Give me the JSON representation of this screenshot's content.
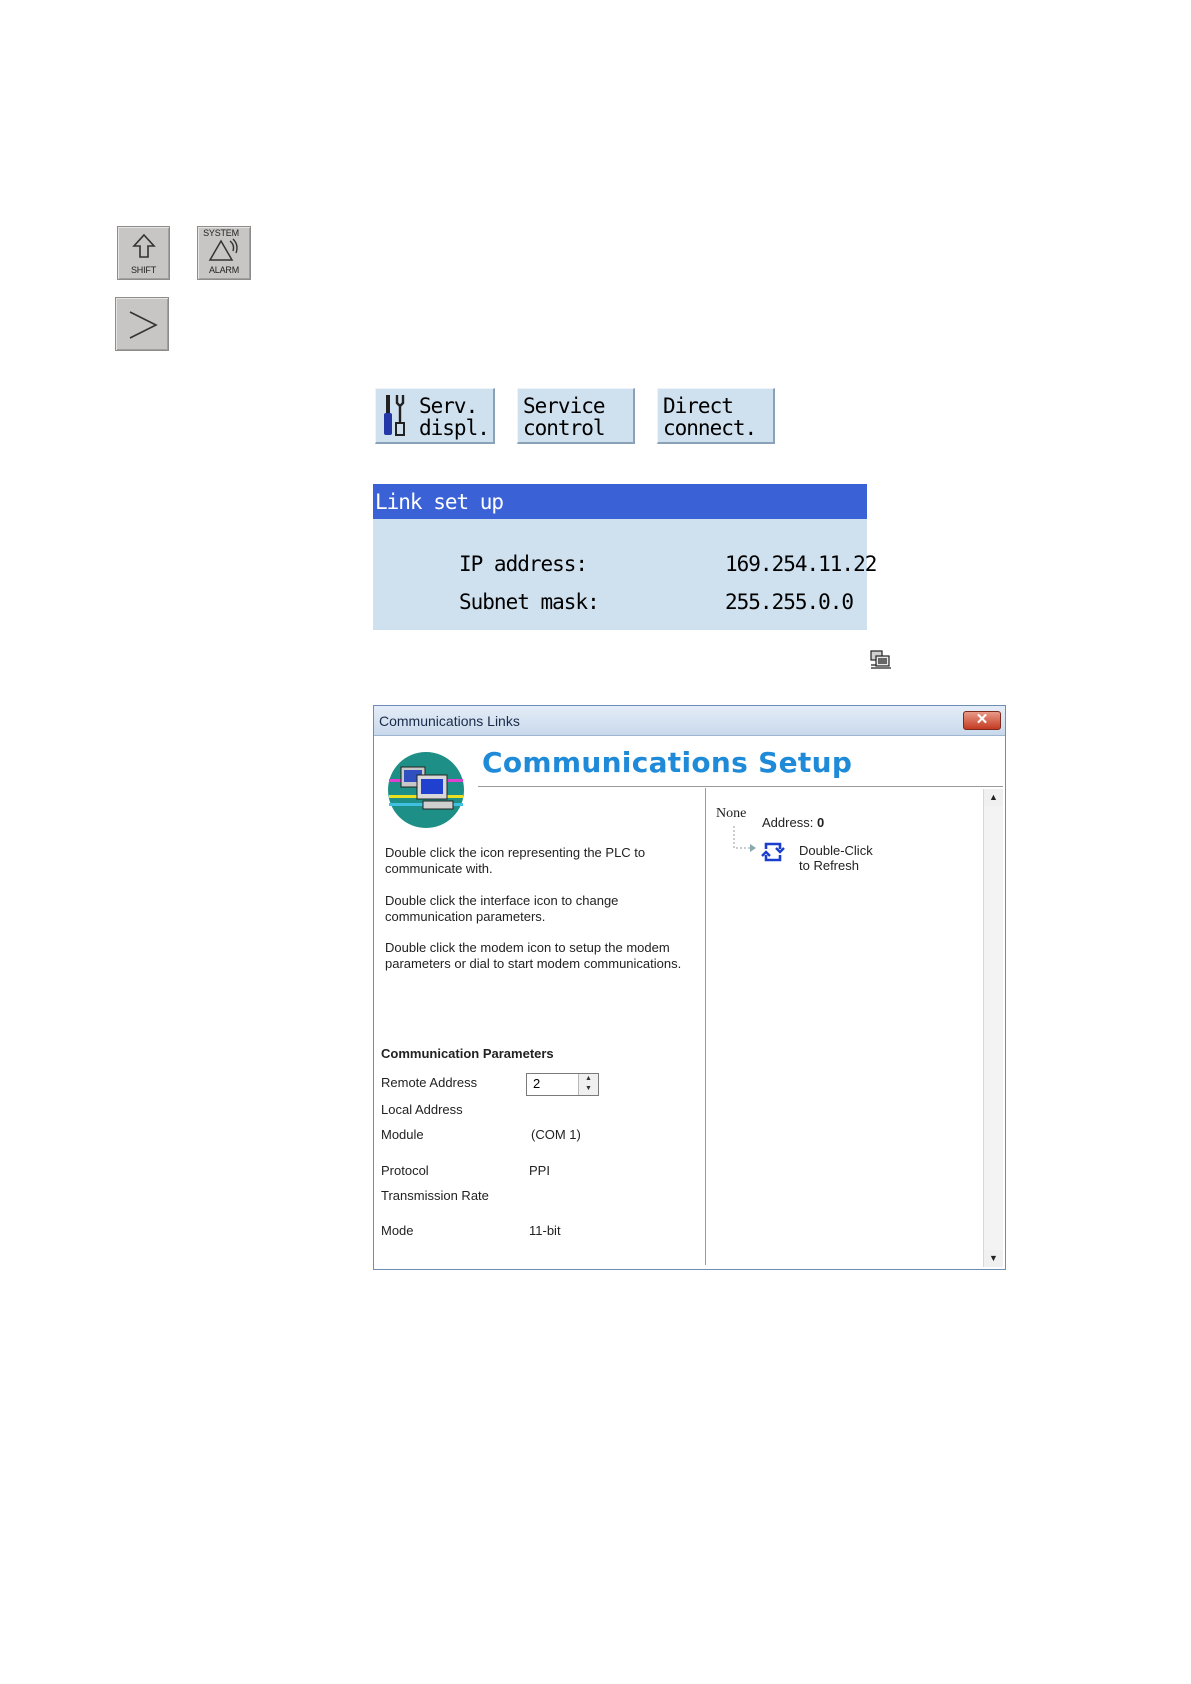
{
  "hardware_keys": {
    "shift_label": "SHIFT",
    "system_label": "SYSTEM",
    "alarm_label": "ALARM"
  },
  "softkeys": {
    "serv_displ": [
      "Serv.",
      "displ."
    ],
    "service_control": [
      "Service",
      "control"
    ],
    "direct_connect": [
      "Direct",
      "connect."
    ]
  },
  "link_panel": {
    "title": "Link set up",
    "ip_label": "IP address:",
    "ip_value": "169.254.11.22",
    "subnet_label": "Subnet mask:",
    "subnet_value": "255.255.0.0"
  },
  "dialog": {
    "title": "Communications Links",
    "setup_title": "Communications Setup",
    "instructions": [
      "Double click the icon representing the PLC to communicate with.",
      "Double click the interface icon to change communication parameters.",
      "Double click the modem icon to setup the modem parameters or dial to start modem communications."
    ],
    "params_heading": "Communication Parameters",
    "params": {
      "remote_address_label": "Remote Address",
      "remote_address_value": "2",
      "local_address_label": "Local Address",
      "module_label": "Module",
      "module_value": "(COM 1)",
      "protocol_label": "Protocol",
      "protocol_value": "PPI",
      "transmission_rate_label": "Transmission Rate",
      "mode_label": "Mode",
      "mode_value": "11-bit"
    },
    "tree": {
      "none_label": "None",
      "address_label": "Address:",
      "address_value": "0",
      "refresh_line1": "Double-Click",
      "refresh_line2": "to Refresh"
    }
  },
  "colors": {
    "panel_bg": "#cfe0ee",
    "panel_header": "#3a62d6",
    "setup_title": "#1e8ad8",
    "refresh_icon": "#1a3fcf"
  }
}
